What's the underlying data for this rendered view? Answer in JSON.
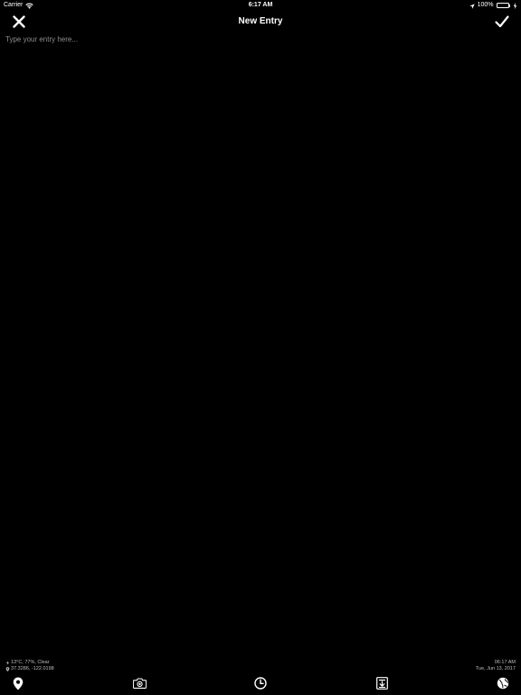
{
  "status_bar": {
    "carrier": "Carrier",
    "time": "6:17 AM",
    "battery_percent": "100%",
    "battery_level": 1.0,
    "battery_color": "#4cd964"
  },
  "nav": {
    "title": "New Entry",
    "close_icon": "close-x-icon",
    "done_icon": "checkmark-icon"
  },
  "entry": {
    "value": "",
    "placeholder": "Type your entry here..."
  },
  "metadata": {
    "weather": "13°C, 77%, Clear",
    "coordinates": "37.3286, -122.0198",
    "time": "06:17 AM",
    "date": "Tue, Jun 13, 2017"
  },
  "toolbar": {
    "items": [
      {
        "icon": "map-pin-icon"
      },
      {
        "icon": "camera-icon"
      },
      {
        "icon": "clock-icon"
      },
      {
        "icon": "template-download-icon"
      },
      {
        "icon": "globe-icon"
      }
    ]
  },
  "colors": {
    "background": "#000000",
    "text": "#ffffff",
    "placeholder": "#8e8e93"
  }
}
